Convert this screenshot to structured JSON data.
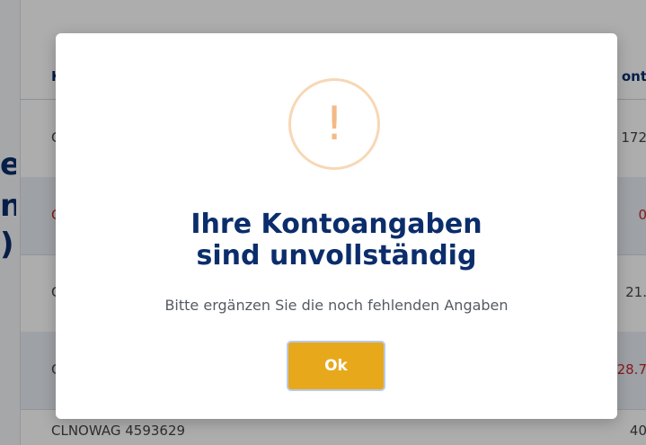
{
  "background": {
    "header": {
      "first_col_partial": "K",
      "last_col_partial": "ont"
    },
    "rows": [
      {
        "left": "C",
        "right": "172",
        "left_color": "normal",
        "right_color": "normal"
      },
      {
        "left": "C",
        "right": "0",
        "left_color": "red",
        "right_color": "red"
      },
      {
        "left": "C",
        "right": "21.",
        "left_color": "normal",
        "right_color": "normal"
      },
      {
        "left": "C",
        "right": "28.7",
        "left_color": "normal",
        "right_color": "red"
      }
    ],
    "bottom_left": "CLNOWAG 4593629",
    "bottom_right": "40",
    "left_strip_letters": [
      "e",
      "n",
      ")"
    ]
  },
  "modal": {
    "icon": "warning-icon",
    "icon_glyph": "!",
    "title_line1": "Ihre Kontoangaben",
    "title_line2": "sind unvollständig",
    "message": "Bitte ergänzen Sie die noch fehlenden Angaben",
    "ok_label": "Ok"
  },
  "colors": {
    "title": "#0b2d6b",
    "ok_button": "#e7a81c",
    "warning_ring": "#f8d7b5",
    "warning_mark": "#f4b987",
    "negative_value": "#c62828"
  }
}
